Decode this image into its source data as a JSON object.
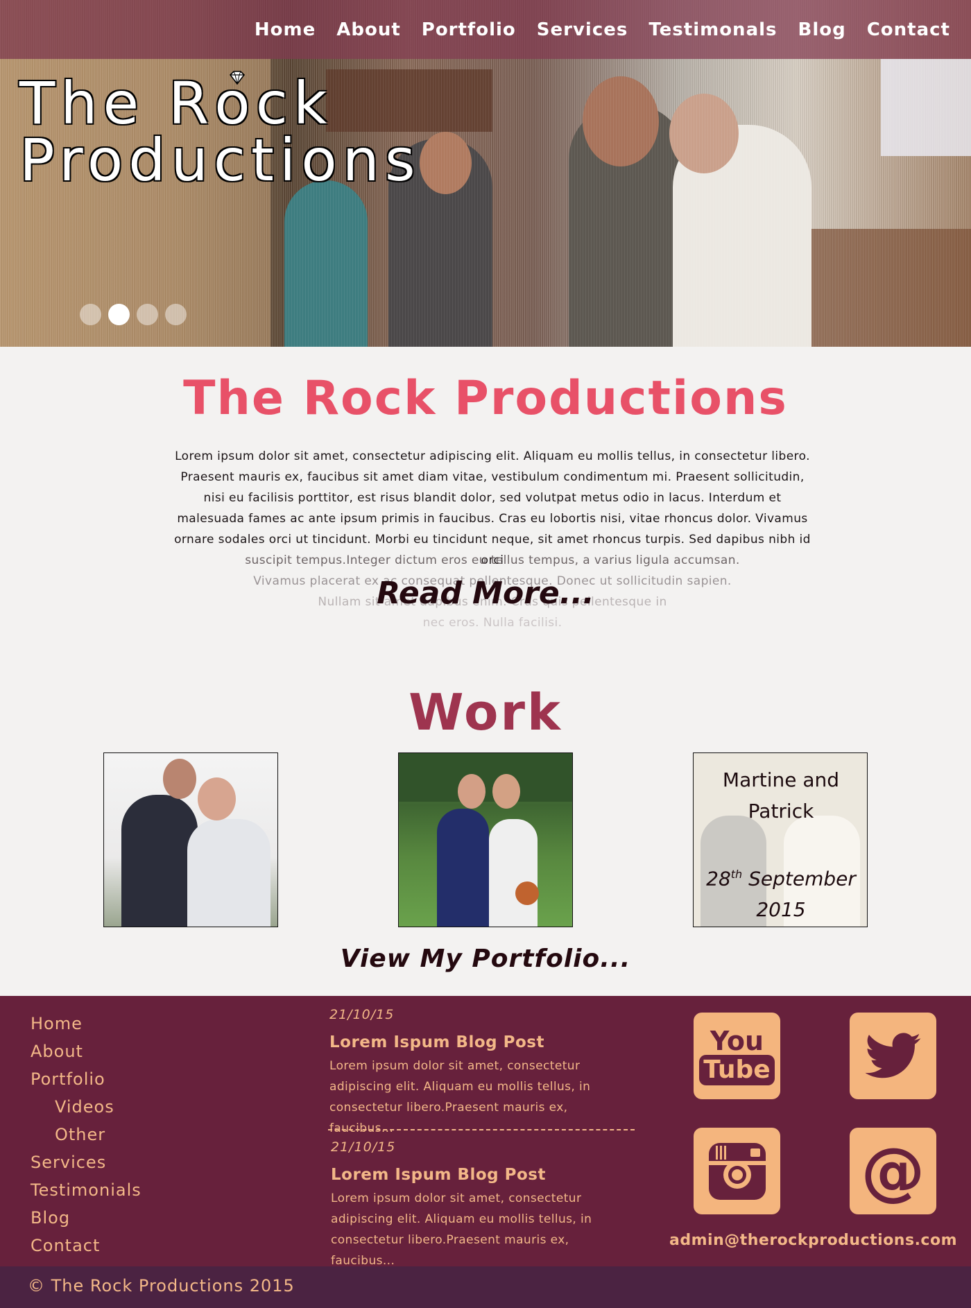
{
  "nav": {
    "items": [
      "Home",
      "About",
      "Portfolio",
      "Services",
      "Testimonals",
      "Blog",
      "Contact"
    ]
  },
  "hero": {
    "logo_line1_a": "The R",
    "logo_line1_ring": "o",
    "logo_line1_b": "ck",
    "logo_line2": "Productions",
    "slider": {
      "count": 4,
      "active_index": 1
    }
  },
  "intro": {
    "title": "The Rock Productions",
    "paragraph": "Lorem ipsum dolor sit amet, consectetur adipiscing elit. Aliquam eu mollis tellus, in consectetur libero. Praesent mauris ex, faucibus sit amet diam vitae, vestibulum condimentum mi. Praesent sollicitudin, nisi eu facilisis porttitor, est risus blandit dolor, sed volutpat metus odio in lacus. Interdum et malesuada fames ac ante ipsum primis in faucibus. Cras eu lobortis nisi, vitae rhoncus dolor. Vivamus ornare sodales orci ut tincidunt. Morbi eu tincidunt neque, sit amet rhoncus turpis. Sed dapibus nibh id orci",
    "fade_lines": [
      "suscipit tempus.Integer dictum eros eu tellus tempus, a varius ligula accumsan.",
      "Vivamus placerat ex ac consequat pellentesque. Donec ut sollicitudin sapien.",
      "Nullam sit amet dapibus enim. Cras quis pellentesque in",
      "nec eros. Nulla facilisi."
    ],
    "read_more": "Read More..."
  },
  "work": {
    "title": "Work",
    "featured": {
      "names": "Martine and Patrick",
      "day": "28",
      "day_suffix": "th",
      "month": "September",
      "year": "2015"
    },
    "view_portfolio": "View My Portfolio..."
  },
  "footer": {
    "nav": [
      {
        "label": "Home",
        "sub": false
      },
      {
        "label": "About",
        "sub": false
      },
      {
        "label": "Portfolio",
        "sub": false
      },
      {
        "label": "Videos",
        "sub": true
      },
      {
        "label": "Other",
        "sub": true
      },
      {
        "label": "Services",
        "sub": false
      },
      {
        "label": "Testimonials",
        "sub": false
      },
      {
        "label": "Blog",
        "sub": false
      },
      {
        "label": "Contact",
        "sub": false
      }
    ],
    "blog_posts": [
      {
        "date": "21/10/15",
        "title": "Lorem Ispum Blog Post",
        "excerpt": "Lorem ipsum dolor sit amet, consectetur adipiscing elit. Aliquam eu mollis tellus, in consectetur libero.Praesent mauris ex, faucibus..."
      },
      {
        "date": "21/10/15",
        "title": "Lorem Ispum Blog Post",
        "excerpt": "Lorem ipsum dolor sit amet, consectetur adipiscing elit. Aliquam eu mollis tellus, in consectetur libero.Praesent mauris ex, faucibus..."
      }
    ],
    "social": {
      "youtube_top": "You",
      "youtube_bottom": "Tube",
      "icons": [
        "youtube-icon",
        "twitter-icon",
        "instagram-icon",
        "email-at-icon"
      ],
      "at_symbol": "@"
    },
    "email": "admin@therockproductions.com",
    "copyright": "© The Rock Productions 2015"
  },
  "colors": {
    "nav_bg": "#823a50",
    "intro_title": "#e85168",
    "work_title": "#9e344f",
    "footer_bg": "#67213c",
    "footer_text": "#f3b888",
    "social_tile": "#f4b57e",
    "copyright_bg": "#4b2342"
  }
}
